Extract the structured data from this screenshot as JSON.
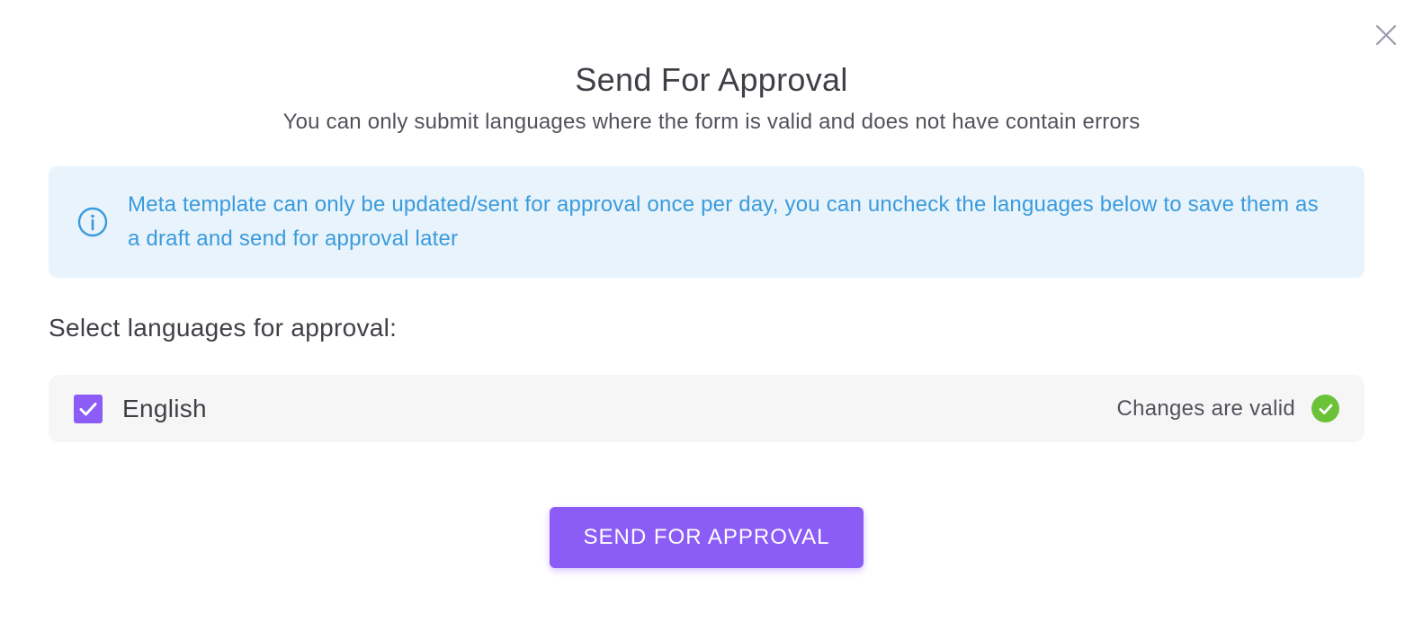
{
  "modal": {
    "title": "Send For Approval",
    "subtitle": "You can only submit languages where the form is valid and does not have contain errors",
    "close_icon": "close-icon"
  },
  "info": {
    "icon": "info-icon",
    "message": "Meta template can only be updated/sent for approval once per day, you can uncheck the languages below to save them as a draft and send for approval later",
    "color": "#3a9bdc",
    "background": "#e8f3fc"
  },
  "languages": {
    "label": "Select languages for approval:",
    "items": [
      {
        "name": "English",
        "checked": true,
        "status": "Changes are valid",
        "status_icon": "check-circle-icon",
        "status_color": "#6bc238"
      }
    ]
  },
  "actions": {
    "send_label": "SEND FOR APPROVAL",
    "accent": "#8b5cf6"
  }
}
